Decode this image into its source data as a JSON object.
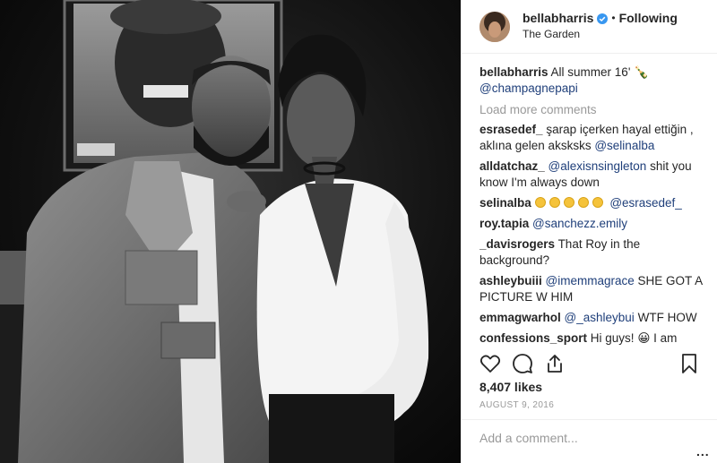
{
  "post": {
    "username": "bellabharris",
    "follow_status": "Following",
    "location": "The Garden",
    "likes": "8,407 likes",
    "date": "AUGUST 9, 2016",
    "add_comment_placeholder": "Add a comment...",
    "more_options": "..."
  },
  "caption": {
    "user": "bellabharris",
    "text": "All summer 16' 🍾",
    "mention": "@champagnepapi"
  },
  "load_more": "Load more comments",
  "comments": [
    {
      "user": "esrasedef_",
      "text": "şarap içerken hayal ettiğin , aklına gelen aksksks",
      "mention": "@selinalba"
    },
    {
      "user": "alldatchaz_",
      "mention": "@alexisnsingleton",
      "text": "shit you know I'm always down"
    },
    {
      "user": "selinalba",
      "mention": "@esrasedef_"
    },
    {
      "user": "roy.tapia",
      "mention": "@sanchezz.emily"
    },
    {
      "user": "_davisrogers",
      "text": "That Roy in the background?"
    },
    {
      "user": "ashleybuiii",
      "mention": "@imemmagrace",
      "text": "SHE GOT A PICTURE W HIM"
    },
    {
      "user": "emmagwarhol",
      "mention": "@_ashleybui",
      "text": "WTF HOW"
    },
    {
      "user": "confessions_sport",
      "text": "Hi guys! 😀  I am going to be starting a Sport Confessions account where I am going to be posting confessions"
    }
  ],
  "icons": [
    "heart-icon",
    "comment-icon",
    "share-icon",
    "bookmark-icon",
    "verified-badge-icon"
  ],
  "colors": {
    "mention": "#1f3f7a",
    "verified": "#3897f0",
    "muted": "#999999"
  }
}
